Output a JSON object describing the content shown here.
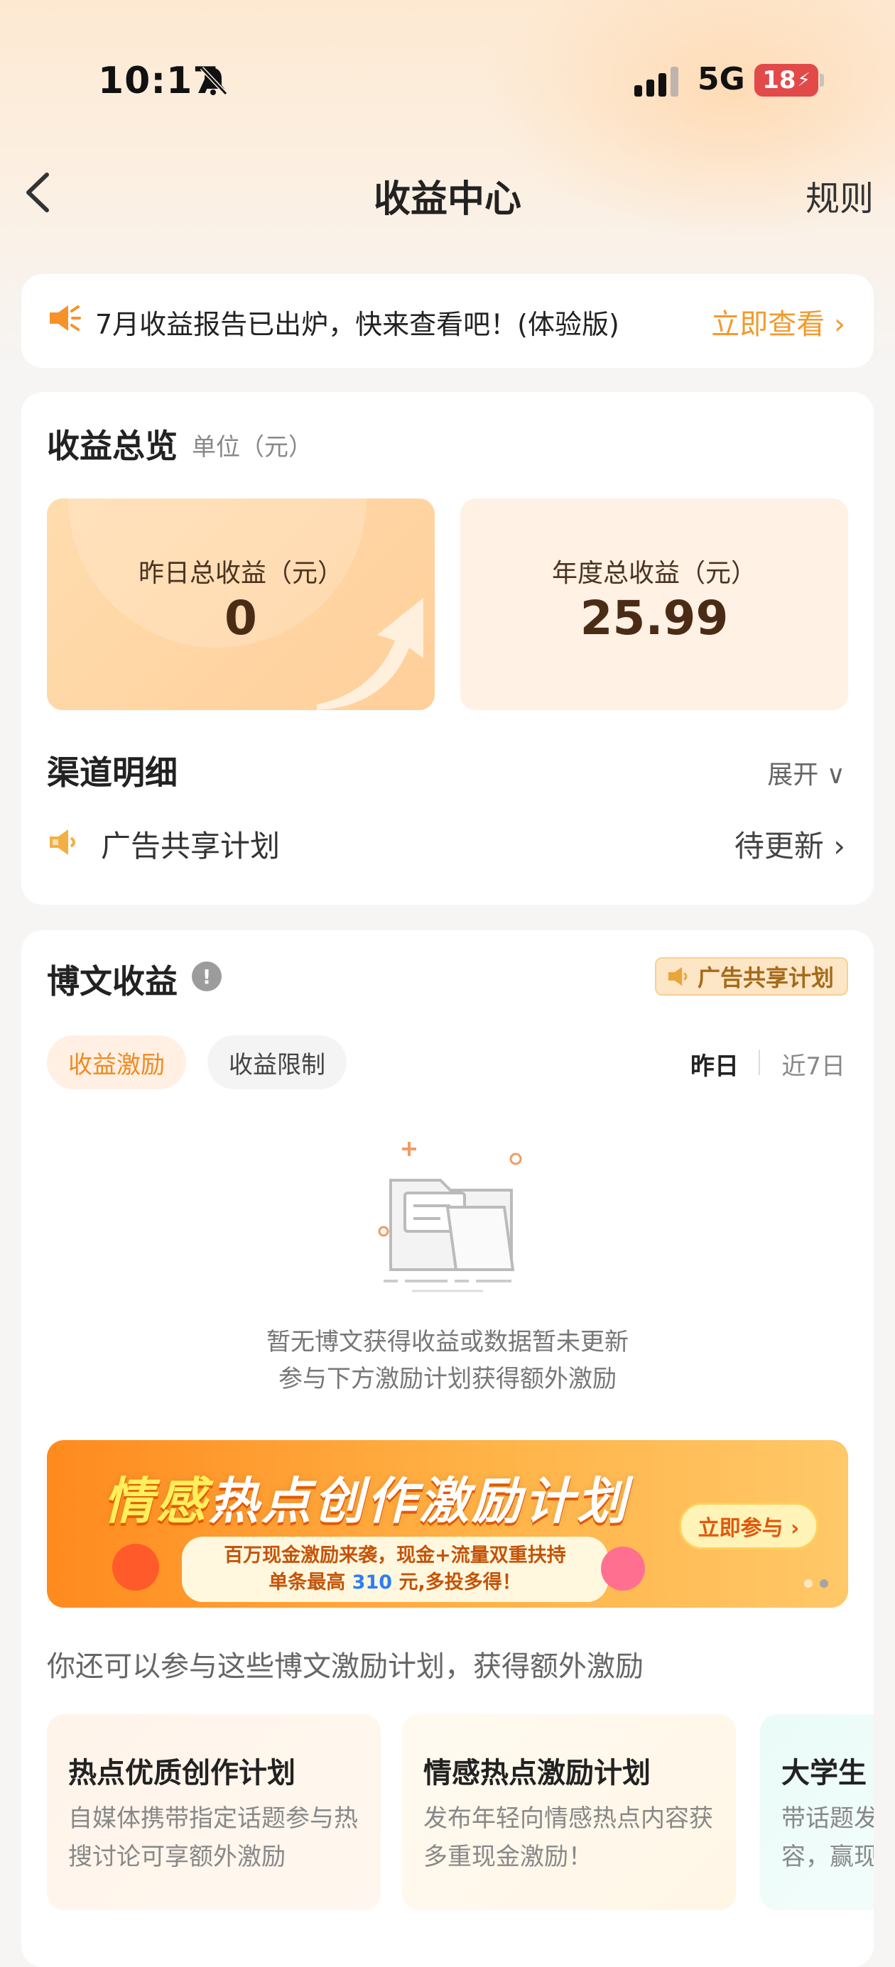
{
  "status_bar": {
    "time": "10:17",
    "network": "5G",
    "battery": "18"
  },
  "nav": {
    "title": "收益中心",
    "rules": "规则"
  },
  "notice": {
    "text": "7月收益报告已出炉，快来查看吧！(体验版)",
    "link": "立即查看 ›"
  },
  "overview": {
    "title": "收益总览",
    "unit": "单位（元）",
    "yesterday_label": "昨日总收益（元）",
    "yesterday_value": "0",
    "annual_label": "年度总收益（元）",
    "annual_value": "25.99"
  },
  "channel": {
    "title": "渠道明细",
    "expand": "展开 ∨",
    "item_label": "广告共享计划",
    "item_status": "待更新 ›"
  },
  "blog": {
    "title": "博文收益",
    "info_icon": "!",
    "badge": "广告共享计划",
    "tabs": [
      "收益激励",
      "收益限制"
    ],
    "day_filters": [
      "昨日",
      "近7日"
    ],
    "empty_line1": "暂无博文获得收益或数据暂未更新",
    "empty_line2": "参与下方激励计划获得额外激励"
  },
  "banner": {
    "title_part1": "情感",
    "title_part2": "热点创作激励计划",
    "sub_line1": "百万现金激励来袭，现金+流量双重扶持",
    "sub_line2_a": "单条最高",
    "sub_line2_num": "310",
    "sub_line2_b": "元,多投多得！",
    "button": "立即参与 ›"
  },
  "more": {
    "text": "你还可以参与这些博文激励计划，获得额外激励",
    "plans": [
      {
        "title": "热点优质创作计划",
        "desc": "自媒体携带指定话题参与热搜讨论可享额外激励"
      },
      {
        "title": "情感热点激励计划",
        "desc": "发布年轻向情感热点内容获多重现金激励！"
      },
      {
        "title": "大学生",
        "desc": "带话题发容，赢现"
      }
    ]
  },
  "colors": {
    "accent": "#f39a2c",
    "card": "#ffffff",
    "bg": "#f6f5f4"
  }
}
